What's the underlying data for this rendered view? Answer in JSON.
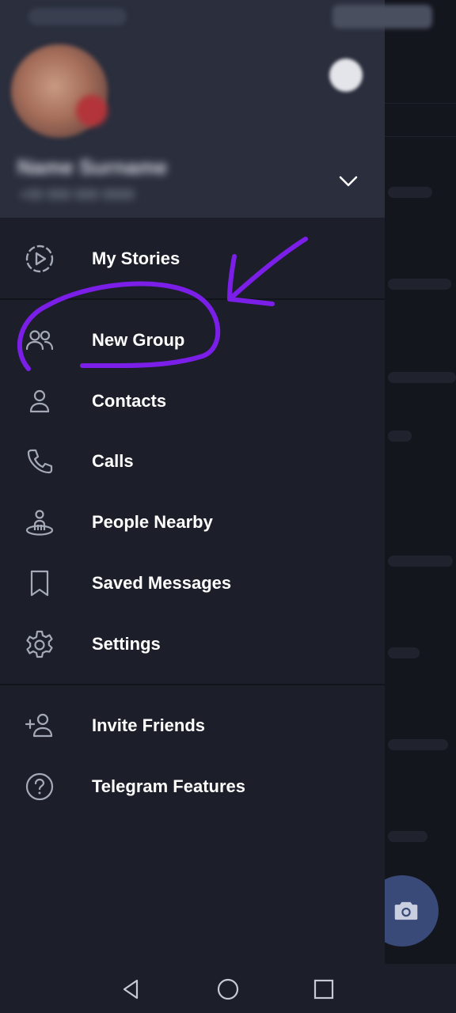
{
  "drawer": {
    "header": {
      "user_name": "Name Surname",
      "user_phone": "+00 000 000 0000"
    },
    "menu_items": [
      {
        "label": "My Stories",
        "icon": "stories-play-icon"
      },
      {
        "label": "New Group",
        "icon": "group-icon"
      },
      {
        "label": "Contacts",
        "icon": "contact-person-icon"
      },
      {
        "label": "Calls",
        "icon": "phone-icon"
      },
      {
        "label": "People Nearby",
        "icon": "people-nearby-icon"
      },
      {
        "label": "Saved Messages",
        "icon": "bookmark-icon"
      },
      {
        "label": "Settings",
        "icon": "gear-icon"
      },
      {
        "label": "Invite Friends",
        "icon": "add-person-icon"
      },
      {
        "label": "Telegram Features",
        "icon": "question-icon"
      }
    ]
  },
  "nav_bar": {
    "buttons": [
      "back-triangle-icon",
      "home-circle-icon",
      "recents-square-icon"
    ]
  },
  "colors": {
    "drawer_bg": "#1c1f2a",
    "header_bg": "#2a2e3d",
    "annotation_purple": "#7b1fe8",
    "fab_bg": "#3a4a78"
  }
}
